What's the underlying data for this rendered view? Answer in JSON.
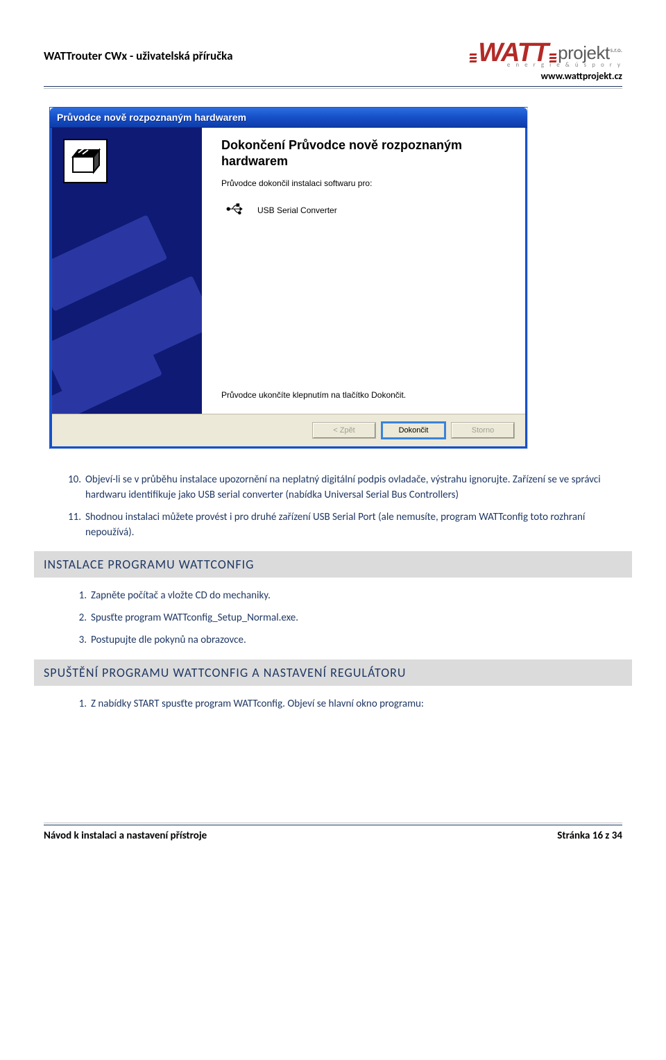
{
  "header": {
    "docTitle": "WATTrouter CWx - uživatelská příručka",
    "logo": {
      "brand": "WATT",
      "suffix": "projekt",
      "sro": "s.r.o.",
      "tagline": "e n e r g i e   &   ú s p o r y"
    },
    "url": "www.wattprojekt.cz"
  },
  "wizard": {
    "title": "Průvodce nově rozpoznaným hardwarem",
    "heading": "Dokončení Průvodce nově rozpoznaným hardwarem",
    "desc": "Průvodce dokončil instalaci softwaru pro:",
    "device": "USB Serial Converter",
    "finish": "Průvodce ukončíte klepnutím na tlačítko Dokončit.",
    "buttons": {
      "back": "< Zpět",
      "finish": "Dokončit",
      "cancel": "Storno"
    }
  },
  "list": {
    "i10": {
      "n": "10.",
      "t": "Objeví-li se v průběhu instalace upozornění na neplatný digitální podpis ovladače, výstrahu ignorujte. Zařízení se ve správci hardwaru identifikuje jako USB serial converter (nabídka Universal Serial Bus Controllers)"
    },
    "i11": {
      "n": "11.",
      "t": "Shodnou instalaci můžete provést i pro druhé zařízení USB Serial Port (ale nemusíte, program WATTconfig toto rozhraní nepoužívá)."
    }
  },
  "section1": "INSTALACE PROGRAMU WATTCONFIG",
  "sub1": {
    "i1": {
      "n": "1.",
      "t": " Zapněte počítač a vložte CD do mechaniky."
    },
    "i2": {
      "n": "2.",
      "t": "Spusťte program WATTconfig_Setup_Normal.exe."
    },
    "i3": {
      "n": "3.",
      "t": "Postupujte dle pokynů na obrazovce."
    }
  },
  "section2": "SPUŠTĚNÍ PROGRAMU WATTCONFIG A NASTAVENÍ REGULÁTORU",
  "sub2": {
    "i1": {
      "n": "1.",
      "t": "Z nabídky START spusťte program WATTconfig. Objeví se hlavní okno programu:"
    }
  },
  "footer": {
    "left": "Návod k instalaci a nastavení přístroje",
    "right": "Stránka 16 z 34"
  }
}
